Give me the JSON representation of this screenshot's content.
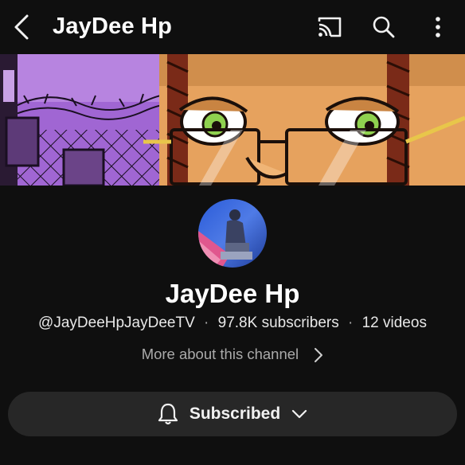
{
  "header": {
    "title": "JayDee Hp",
    "icons": [
      "back-icon",
      "cast-icon",
      "search-icon",
      "more-vertical-icon"
    ]
  },
  "channel": {
    "name": "JayDee Hp",
    "handle": "@JayDeeHpJayDeeTV",
    "subscribers": "97.8K subscribers",
    "videos": "12 videos",
    "separator": "·",
    "more_about": "More about this channel"
  },
  "subscribe": {
    "label": "Subscribed",
    "icons": [
      "bell-icon",
      "chevron-down-icon"
    ]
  },
  "colors": {
    "background": "#0f0f0f",
    "button_bg": "#272727",
    "banner_purple": "#a468d8",
    "banner_skin": "#e8a35a",
    "eye_green": "#8fd14f"
  }
}
